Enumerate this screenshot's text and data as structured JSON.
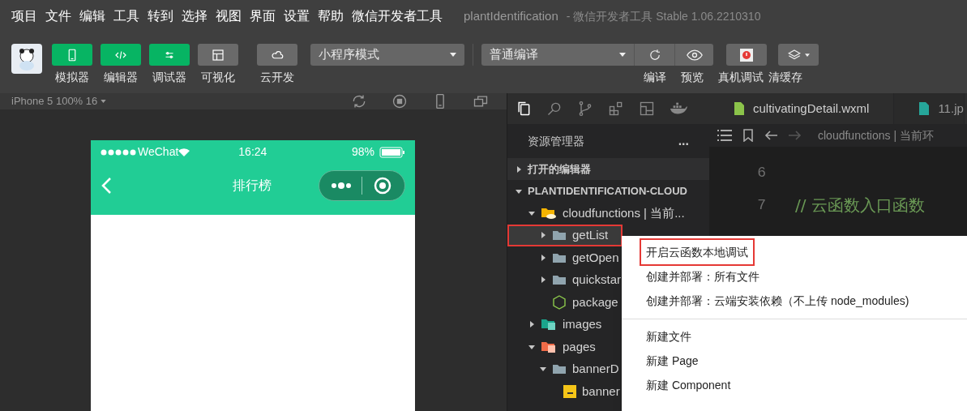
{
  "menu_bar": {
    "items": [
      "项目",
      "文件",
      "编辑",
      "工具",
      "转到",
      "选择",
      "视图",
      "界面",
      "设置",
      "帮助",
      "微信开发者工具"
    ],
    "title": "plantIdentification",
    "subtitle": "- 微信开发者工具 Stable 1.06.2210310"
  },
  "toolbar": {
    "panel_buttons": [
      {
        "label": "模拟器",
        "kind": "phone",
        "on": true
      },
      {
        "label": "编辑器",
        "kind": "code",
        "on": true
      },
      {
        "label": "调试器",
        "kind": "sliders",
        "on": true
      },
      {
        "label": "可视化",
        "kind": "layout",
        "on": false
      },
      {
        "label": "云开发",
        "kind": "cloud",
        "on": false
      }
    ],
    "mode_select": "小程序模式",
    "compile_select": "普通编译",
    "action_labels": [
      "编译",
      "预览",
      "真机调试",
      "清缓存"
    ]
  },
  "simulator": {
    "device_select": "iPhone 5 100% 16",
    "status_bar": {
      "carrier": "WeChat",
      "time": "16:24",
      "battery": "98%"
    },
    "nav_title": "排行榜"
  },
  "explorer": {
    "title": "资源管理器",
    "more": "...",
    "sections": [
      {
        "label": "打开的编辑器",
        "expanded": false
      },
      {
        "label": "PLANTIDENTIFICATION-CLOUD",
        "expanded": true
      }
    ],
    "tree": [
      {
        "label": "cloudfunctions | 当前...",
        "kind": "cloud-folder",
        "expanded": true,
        "selected": false,
        "children": [
          {
            "label": "getList",
            "kind": "folder",
            "expanded": false,
            "selected": true
          },
          {
            "label": "getOpen",
            "kind": "folder",
            "expanded": false,
            "selected": false
          },
          {
            "label": "quickstar",
            "kind": "folder",
            "expanded": false,
            "selected": false
          },
          {
            "label": "package",
            "kind": "node",
            "selected": false
          }
        ]
      },
      {
        "label": "images",
        "kind": "image-folder",
        "expanded": false,
        "selected": false
      },
      {
        "label": "pages",
        "kind": "pages-folder",
        "expanded": true,
        "selected": false,
        "children": [
          {
            "label": "bannerD",
            "kind": "folder",
            "expanded": true,
            "selected": false,
            "children": [
              {
                "label": "banner",
                "kind": "js",
                "selected": false
              }
            ]
          }
        ]
      }
    ]
  },
  "editor": {
    "tabs": [
      {
        "label": "cultivatingDetail.wxml",
        "kind": "wxml",
        "selected": true
      },
      {
        "label": "11.jp",
        "kind": "image",
        "selected": false
      }
    ],
    "breadcrumb": "cloudfunctions | 当前环",
    "lines": [
      {
        "number": "6",
        "kind": "blank"
      },
      {
        "number": "7",
        "text": "// 云函数入口函数",
        "kind": "comment"
      }
    ]
  },
  "context_menu": {
    "groups": [
      [
        {
          "label": "开启云函数本地调试",
          "selected": true
        },
        {
          "label": "创建并部署：所有文件",
          "selected": false
        },
        {
          "label": "创建并部署：云端安装依赖（不上传 node_modules)",
          "selected": false
        }
      ],
      [
        {
          "label": "新建文件",
          "selected": false
        },
        {
          "label": "新建 Page",
          "selected": false
        },
        {
          "label": "新建 Component",
          "selected": false
        }
      ]
    ]
  }
}
